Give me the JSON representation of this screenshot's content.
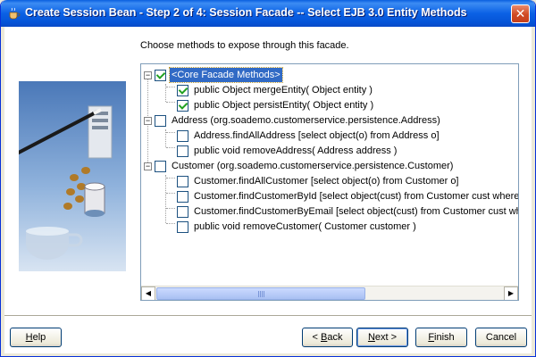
{
  "window": {
    "title": "Create Session Bean - Step 2 of 4: Session Facade -- Select EJB 3.0 Entity Methods",
    "close_symbol": "✕"
  },
  "instruction": "Choose methods to expose through this facade.",
  "tree": {
    "root": {
      "label": "<Core Facade Methods>",
      "expander": "−",
      "checked": true,
      "children": [
        {
          "label": "public Object mergeEntity( Object entity )",
          "checked": true
        },
        {
          "label": "public Object persistEntity( Object entity )",
          "checked": true
        }
      ]
    },
    "address": {
      "label": "Address (org.soademo.customerservice.persistence.Address)",
      "expander": "−",
      "checked": false,
      "children": [
        {
          "label": "Address.findAllAddress [select object(o) from Address o]",
          "checked": false
        },
        {
          "label": "public void removeAddress( Address address )",
          "checked": false
        }
      ]
    },
    "customer": {
      "label": "Customer (org.soademo.customerservice.persistence.Customer)",
      "expander": "−",
      "checked": false,
      "children": [
        {
          "label": "Customer.findAllCustomer [select object(o) from Customer o]",
          "checked": false
        },
        {
          "label": "Customer.findCustomerById [select object(cust) from Customer cust where",
          "checked": false
        },
        {
          "label": "Customer.findCustomerByEmail [select object(cust) from Customer cust whe",
          "checked": false
        },
        {
          "label": "public void removeCustomer( Customer customer )",
          "checked": false
        }
      ]
    }
  },
  "scrollbar": {
    "left_arrow": "◀",
    "right_arrow": "▶"
  },
  "buttons": {
    "help": {
      "mnemonic": "H",
      "rest": "elp"
    },
    "back": {
      "prefix": "< ",
      "mnemonic": "B",
      "rest": "ack"
    },
    "next": {
      "mnemonic": "N",
      "rest": "ext >"
    },
    "finish": {
      "mnemonic": "F",
      "rest": "inish"
    },
    "cancel": "Cancel"
  },
  "icons": {
    "app": "coffee-cup-icon",
    "graphic": "wizard-illustration-icon"
  }
}
